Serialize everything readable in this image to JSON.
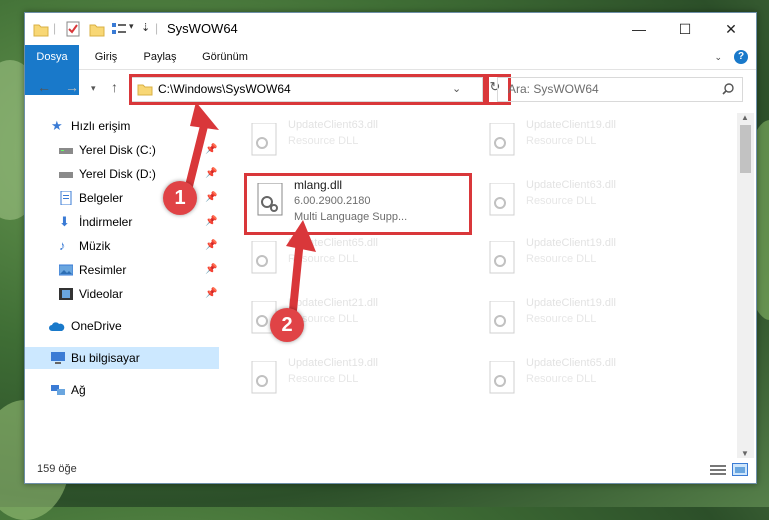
{
  "window": {
    "title": "SysWOW64"
  },
  "ribbon": {
    "tabs": [
      "Dosya",
      "Giriş",
      "Paylaş",
      "Görünüm"
    ],
    "help": "?"
  },
  "address": {
    "path": "C:\\Windows\\SysWOW64"
  },
  "search": {
    "placeholder": "Ara: SysWOW64"
  },
  "sidebar": {
    "items": [
      {
        "label": "Hızlı erişim"
      },
      {
        "label": "Yerel Disk (C:)"
      },
      {
        "label": "Yerel Disk (D:)"
      },
      {
        "label": "Belgeler"
      },
      {
        "label": "İndirmeler"
      },
      {
        "label": "Müzik"
      },
      {
        "label": "Resimler"
      },
      {
        "label": "Videolar"
      },
      {
        "label": "OneDrive"
      },
      {
        "label": "Bu bilgisayar"
      },
      {
        "label": "Ağ"
      }
    ]
  },
  "files": {
    "main": {
      "name": "mlang.dll",
      "version": "6.00.2900.2180",
      "description": "Multi Language Supp..."
    },
    "left": [
      {
        "name": "UpdateClient63.dll",
        "type": "Resource DLL"
      },
      {
        "name": "UpdateClient65.dll",
        "type": "Resource DLL"
      },
      {
        "name": "UpdateClient21.dll",
        "type": "Resource DLL"
      },
      {
        "name": "UpdateClient19.dll",
        "type": "Resource DLL"
      }
    ],
    "right": [
      {
        "name": "UpdateClient19.dll",
        "type": "Resource DLL"
      },
      {
        "name": "UpdateClient63.dll",
        "type": "Resource DLL"
      },
      {
        "name": "UpdateClient19.dll",
        "type": "Resource DLL"
      },
      {
        "name": "UpdateClient19.dll",
        "type": "Resource DLL"
      },
      {
        "name": "UpdateClient65.dll",
        "type": "Resource DLL"
      }
    ]
  },
  "status": {
    "count": "159 öğe"
  },
  "callouts": [
    "1",
    "2"
  ],
  "colors": {
    "accent": "#1979ca",
    "highlight": "#d9373a",
    "selection": "#cce8ff"
  }
}
